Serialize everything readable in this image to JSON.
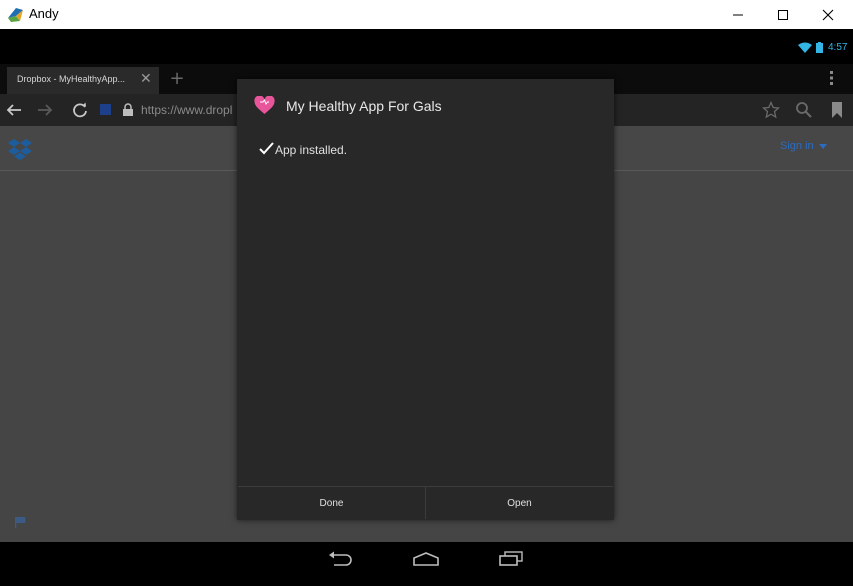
{
  "window": {
    "title": "Andy",
    "controls": {
      "minimize_icon": "minimize-icon",
      "maximize_icon": "maximize-icon",
      "close_icon": "close-icon"
    }
  },
  "status_bar": {
    "time": "4:57",
    "icons": [
      "wifi-icon",
      "battery-icon"
    ],
    "accent_color": "#33b5e5"
  },
  "browser": {
    "tab": {
      "title": "Dropbox - MyHealthyApp...",
      "close_glyph": "✕"
    },
    "new_tab_glyph": "+",
    "url": "https://www.dropl",
    "toolbar_icons": [
      "back-icon",
      "forward-icon",
      "reload-icon",
      "lock-icon",
      "star-icon",
      "search-icon",
      "bookmark-icon",
      "menu-icon"
    ]
  },
  "webpage": {
    "logo": "dropbox-logo",
    "sign_in": "Sign in",
    "link_color": "#2b6cc0"
  },
  "dialog": {
    "title": "My Healthy App For Gals",
    "app_icon": "heart-icon",
    "app_icon_color": "#e8559a",
    "message": "App installed.",
    "buttons": {
      "done": "Done",
      "open": "Open"
    }
  },
  "nav_bar": {
    "icons": [
      "back-icon",
      "home-icon",
      "recents-icon"
    ]
  }
}
